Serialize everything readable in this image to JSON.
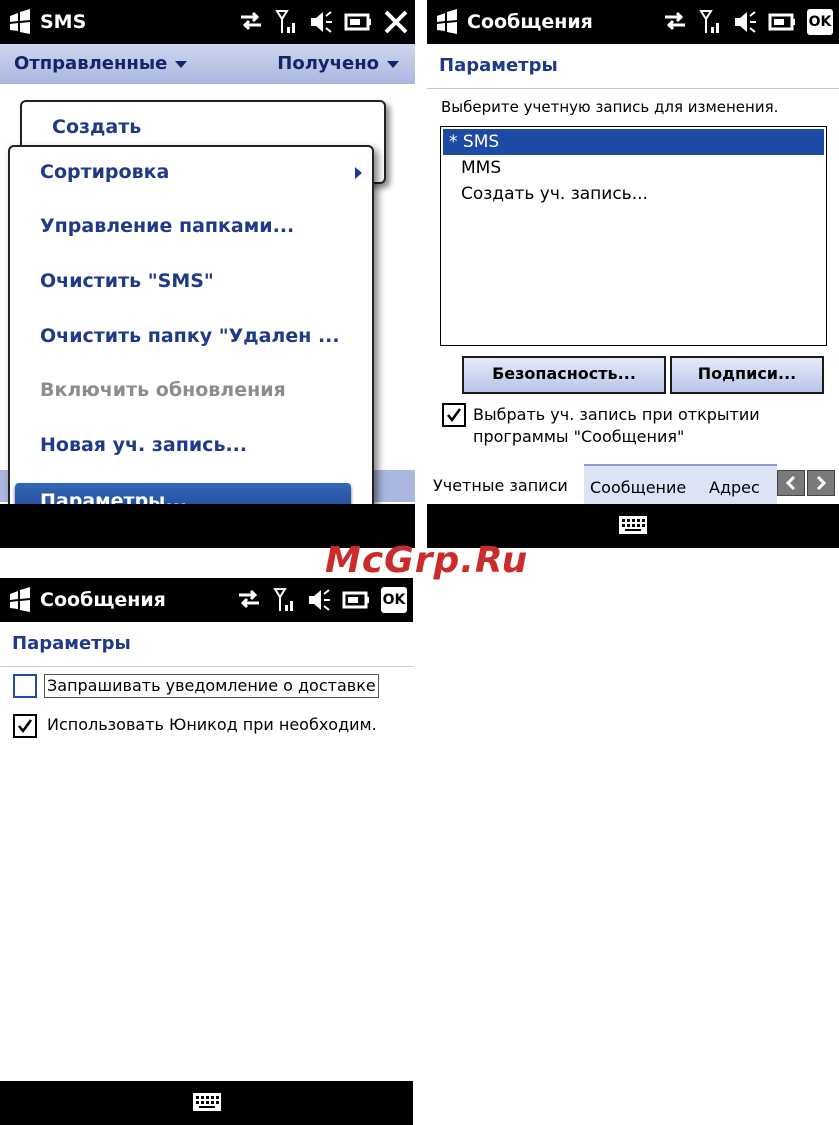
{
  "screen1": {
    "title": "SMS",
    "menubar": {
      "left": "Отправленные",
      "right": "Получено"
    },
    "popup_top": "Создать",
    "menu": [
      {
        "label": "Сортировка",
        "state": "normal",
        "has_submenu": true
      },
      {
        "label": "Управление папками...",
        "state": "normal"
      },
      {
        "label": "Очистить \"SMS\"",
        "state": "normal"
      },
      {
        "label": "Очистить папку \"Удален ...",
        "state": "normal"
      },
      {
        "label": "Включить обновления",
        "state": "disabled"
      },
      {
        "label": "Новая уч. запись...",
        "state": "normal"
      },
      {
        "label": "Параметры...",
        "state": "selected"
      }
    ]
  },
  "screen2": {
    "title": "Сообщения",
    "header": "Параметры",
    "prompt": "Выберите учетную запись для изменения.",
    "accounts": [
      "* SMS",
      "MMS",
      "Создать уч. запись..."
    ],
    "selected_account": "* SMS",
    "buttons": {
      "security": "Безопасность...",
      "signatures": "Подписи..."
    },
    "checkbox": {
      "label_line1": "Выбрать уч. запись при открытии",
      "label_line2": "программы \"Сообщения\"",
      "checked": true
    },
    "tabs": [
      "Учетные записи",
      "Сообщение",
      "Адрес"
    ],
    "ok": "OK"
  },
  "screen3": {
    "title": "Сообщения",
    "header": "Параметры",
    "options": [
      {
        "label": "Запрашивать уведомление о доставке",
        "checked": false
      },
      {
        "label": "Использовать Юникод при необходим.",
        "checked": true
      }
    ],
    "ok": "OK"
  },
  "watermark": "McGrp.Ru",
  "colors": {
    "title_bg": "#000000",
    "header_text": "#1f3a88",
    "selection": "#1c4aa5",
    "menubar": "#a9b6df"
  }
}
